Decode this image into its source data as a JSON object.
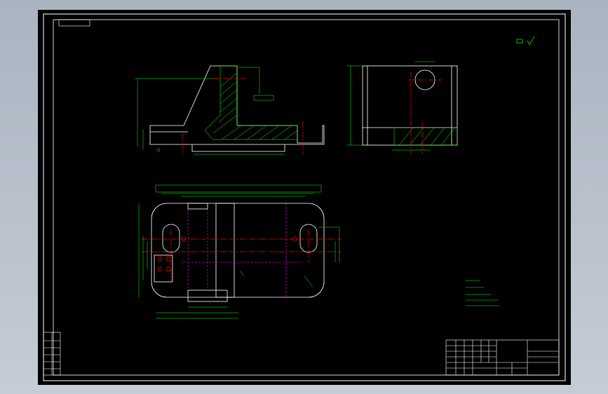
{
  "title_block": {
    "rows": [
      [
        "",
        "",
        "",
        "",
        "",
        "",
        "",
        ""
      ],
      [
        "",
        "",
        "",
        "",
        "",
        "",
        "",
        ""
      ],
      [
        "",
        "",
        "",
        "",
        "",
        "",
        "",
        ""
      ]
    ]
  },
  "colors": {
    "viewport_bg": "#000000",
    "frame": "#ffffff",
    "outline": "#00ff00",
    "center_line": "#ff0000",
    "hidden_line": "#ff00ff",
    "dimension": "#00ff00"
  },
  "icons": {
    "roughness": "roughness-symbol-icon"
  }
}
